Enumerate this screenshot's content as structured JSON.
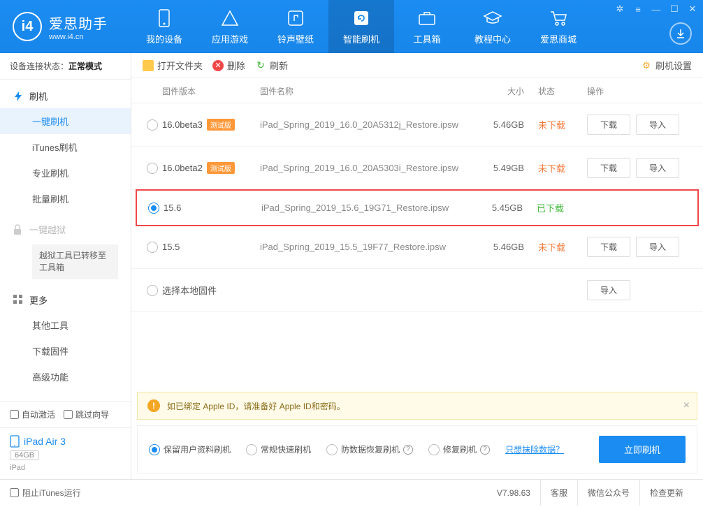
{
  "app": {
    "name": "爱思助手",
    "url": "www.i4.cn",
    "logo_letter": "i4"
  },
  "top_tabs": [
    {
      "label": "我的设备"
    },
    {
      "label": "应用游戏"
    },
    {
      "label": "铃声壁纸"
    },
    {
      "label": "智能刷机"
    },
    {
      "label": "工具箱"
    },
    {
      "label": "教程中心"
    },
    {
      "label": "爱思商城"
    }
  ],
  "conn_status": {
    "label": "设备连接状态：",
    "value": "正常模式"
  },
  "sidebar": {
    "flash_section": "刷机",
    "items": [
      "一键刷机",
      "iTunes刷机",
      "专业刷机",
      "批量刷机"
    ],
    "jailbreak_section": "一键越狱",
    "jailbreak_note": "越狱工具已转移至工具箱",
    "more_section": "更多",
    "more_items": [
      "其他工具",
      "下载固件",
      "高级功能"
    ],
    "auto_activate": "自动激活",
    "skip_guide": "跳过向导"
  },
  "device": {
    "name": "iPad Air 3",
    "storage": "64GB",
    "type": "iPad"
  },
  "toolbar": {
    "open_folder": "打开文件夹",
    "delete": "删除",
    "refresh": "刷新",
    "settings": "刷机设置"
  },
  "table": {
    "headers": {
      "version": "固件版本",
      "name": "固件名称",
      "size": "大小",
      "status": "状态",
      "action": "操作"
    },
    "download_btn": "下载",
    "import_btn": "导入",
    "local_firmware": "选择本地固件",
    "beta_badge": "测试版",
    "status_not": "未下载",
    "status_done": "已下载",
    "rows": [
      {
        "version": "16.0beta3",
        "beta": true,
        "name": "iPad_Spring_2019_16.0_20A5312j_Restore.ipsw",
        "size": "5.46GB",
        "downloaded": false,
        "selected": false
      },
      {
        "version": "16.0beta2",
        "beta": true,
        "name": "iPad_Spring_2019_16.0_20A5303i_Restore.ipsw",
        "size": "5.49GB",
        "downloaded": false,
        "selected": false
      },
      {
        "version": "15.6",
        "beta": false,
        "name": "iPad_Spring_2019_15.6_19G71_Restore.ipsw",
        "size": "5.45GB",
        "downloaded": true,
        "selected": true
      },
      {
        "version": "15.5",
        "beta": false,
        "name": "iPad_Spring_2019_15.5_19F77_Restore.ipsw",
        "size": "5.46GB",
        "downloaded": false,
        "selected": false
      }
    ]
  },
  "alert": "如已绑定 Apple ID，请准备好 Apple ID和密码。",
  "flash_options": {
    "keep_data": "保留用户资料刷机",
    "normal": "常规快速刷机",
    "recovery": "防数据恢复刷机",
    "repair": "修复刷机",
    "erase_link": "只想抹除数据？",
    "flash_btn": "立即刷机"
  },
  "footer": {
    "block_itunes": "阻止iTunes运行",
    "version": "V7.98.63",
    "support": "客服",
    "wechat": "微信公众号",
    "update": "检查更新"
  }
}
